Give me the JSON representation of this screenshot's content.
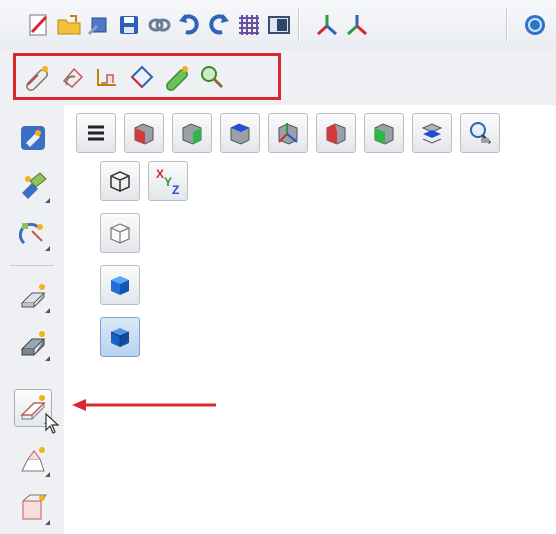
{
  "top_toolbar": {
    "groups": [
      [
        "new-document-icon",
        "open-folder-icon",
        "save-as-icon",
        "save-icon",
        "link-icon",
        "undo-icon",
        "redo-icon",
        "grid-icon",
        "panel-icon"
      ],
      [
        "axis-y-icon",
        "axis-z-icon"
      ],
      [
        "globe-icon"
      ]
    ]
  },
  "feature_toolbar": {
    "items": [
      "extrude-feature-icon",
      "revolve-feature-icon",
      "sweep-feature-icon",
      "loft-feature-icon",
      "solid-feature-icon",
      "search-feature-icon"
    ],
    "highlight_color": "#d9282f"
  },
  "left_toolbar": {
    "items": [
      "paint-icon",
      "transform-icon",
      "rotate-edit-icon",
      "solid-box-icon",
      "surface-box-icon",
      "wire-box-icon",
      "cone-box-icon",
      "section-box-icon"
    ],
    "active": "wire-box-icon"
  },
  "view_panel": {
    "row1": [
      "menu-icon",
      "front-view-icon",
      "top-green-view-icon",
      "top-view-icon",
      "axis-view-icon",
      "right-view-icon",
      "left-green-view-icon",
      "section-view-icon",
      "zoom-view-icon"
    ],
    "row2": [
      "wireframe-icon",
      "xyz-axis-icon"
    ],
    "column": [
      "wire-cube-icon",
      "blue-cube-icon",
      "blue-cube-selected-icon"
    ],
    "axis_labels": {
      "x": "X",
      "y": "Y",
      "z": "Z"
    }
  },
  "colors": {
    "arrow": "#d9282f",
    "selected_background": "#b7d2ee",
    "blue_cube": "#1f6fd6"
  }
}
